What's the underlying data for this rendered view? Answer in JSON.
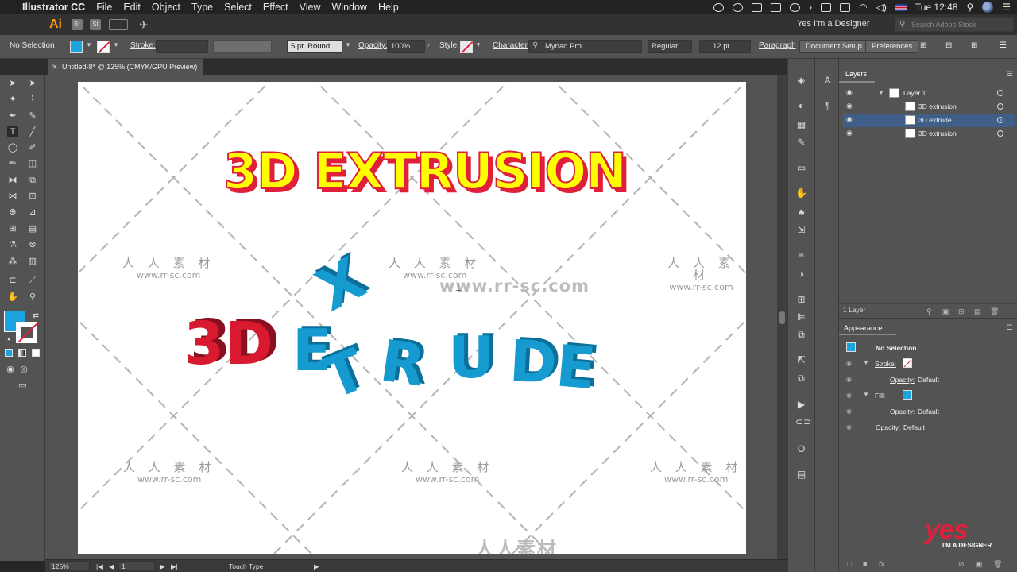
{
  "menubar": {
    "app_name": "Illustrator CC",
    "items": [
      "File",
      "Edit",
      "Object",
      "Type",
      "Select",
      "Effect",
      "View",
      "Window",
      "Help"
    ],
    "clock": "Tue 12:48"
  },
  "appbar": {
    "logo": "Ai",
    "bridge": "Br",
    "stock": "St",
    "workspace": "Yes I'm a Designer",
    "stock_search_placeholder": "Search Adobe Stock"
  },
  "control": {
    "selection": "No Selection",
    "stroke_label": "Stroke:",
    "brush": "5 pt. Round",
    "opacity_label": "Opacity:",
    "opacity_value": "100%",
    "style_label": "Style:",
    "character_label": "Character:",
    "font": "Myriad Pro",
    "font_style": "Regular",
    "font_size": "12 pt",
    "paragraph_label": "Paragraph",
    "document_setup": "Document Setup",
    "preferences": "Preferences",
    "fill_color": "#1ba4e0"
  },
  "document": {
    "tab_title": "Untitled-8* @ 125% (CMYK/GPU Preview)"
  },
  "artwork": {
    "headline": "3D EXTRUSION",
    "headline_fill": "#ffff00",
    "headline_shadow": "#e0203a",
    "extrude_red_word": "3D",
    "extrude_blue_letters": [
      "E",
      "X",
      "T",
      "R",
      "U",
      "D",
      "E"
    ],
    "red": "#e0203a",
    "blue": "#169bd0",
    "watermark_cn": "人 人 素 材",
    "watermark_url": "www.rr-sc.com",
    "center_watermark": "www.rr-sc.com",
    "bottom_watermark": "人人素材"
  },
  "layers": {
    "tab": "Layers",
    "parent": "Layer 1",
    "items": [
      "3D extrusion",
      "3D extrude",
      "3D extrusion"
    ],
    "count": "1 Layer"
  },
  "appearance": {
    "tab": "Appearance",
    "selection": "No Selection",
    "stroke_label": "Stroke:",
    "fill_label": "Fill:",
    "opacity_label": "Opacity:",
    "opacity_value": "Default"
  },
  "status": {
    "zoom": "125%",
    "page": "1",
    "tool": "Touch Type"
  },
  "brand": {
    "logo": "yes",
    "tagline": "I'M A DESIGNER"
  }
}
